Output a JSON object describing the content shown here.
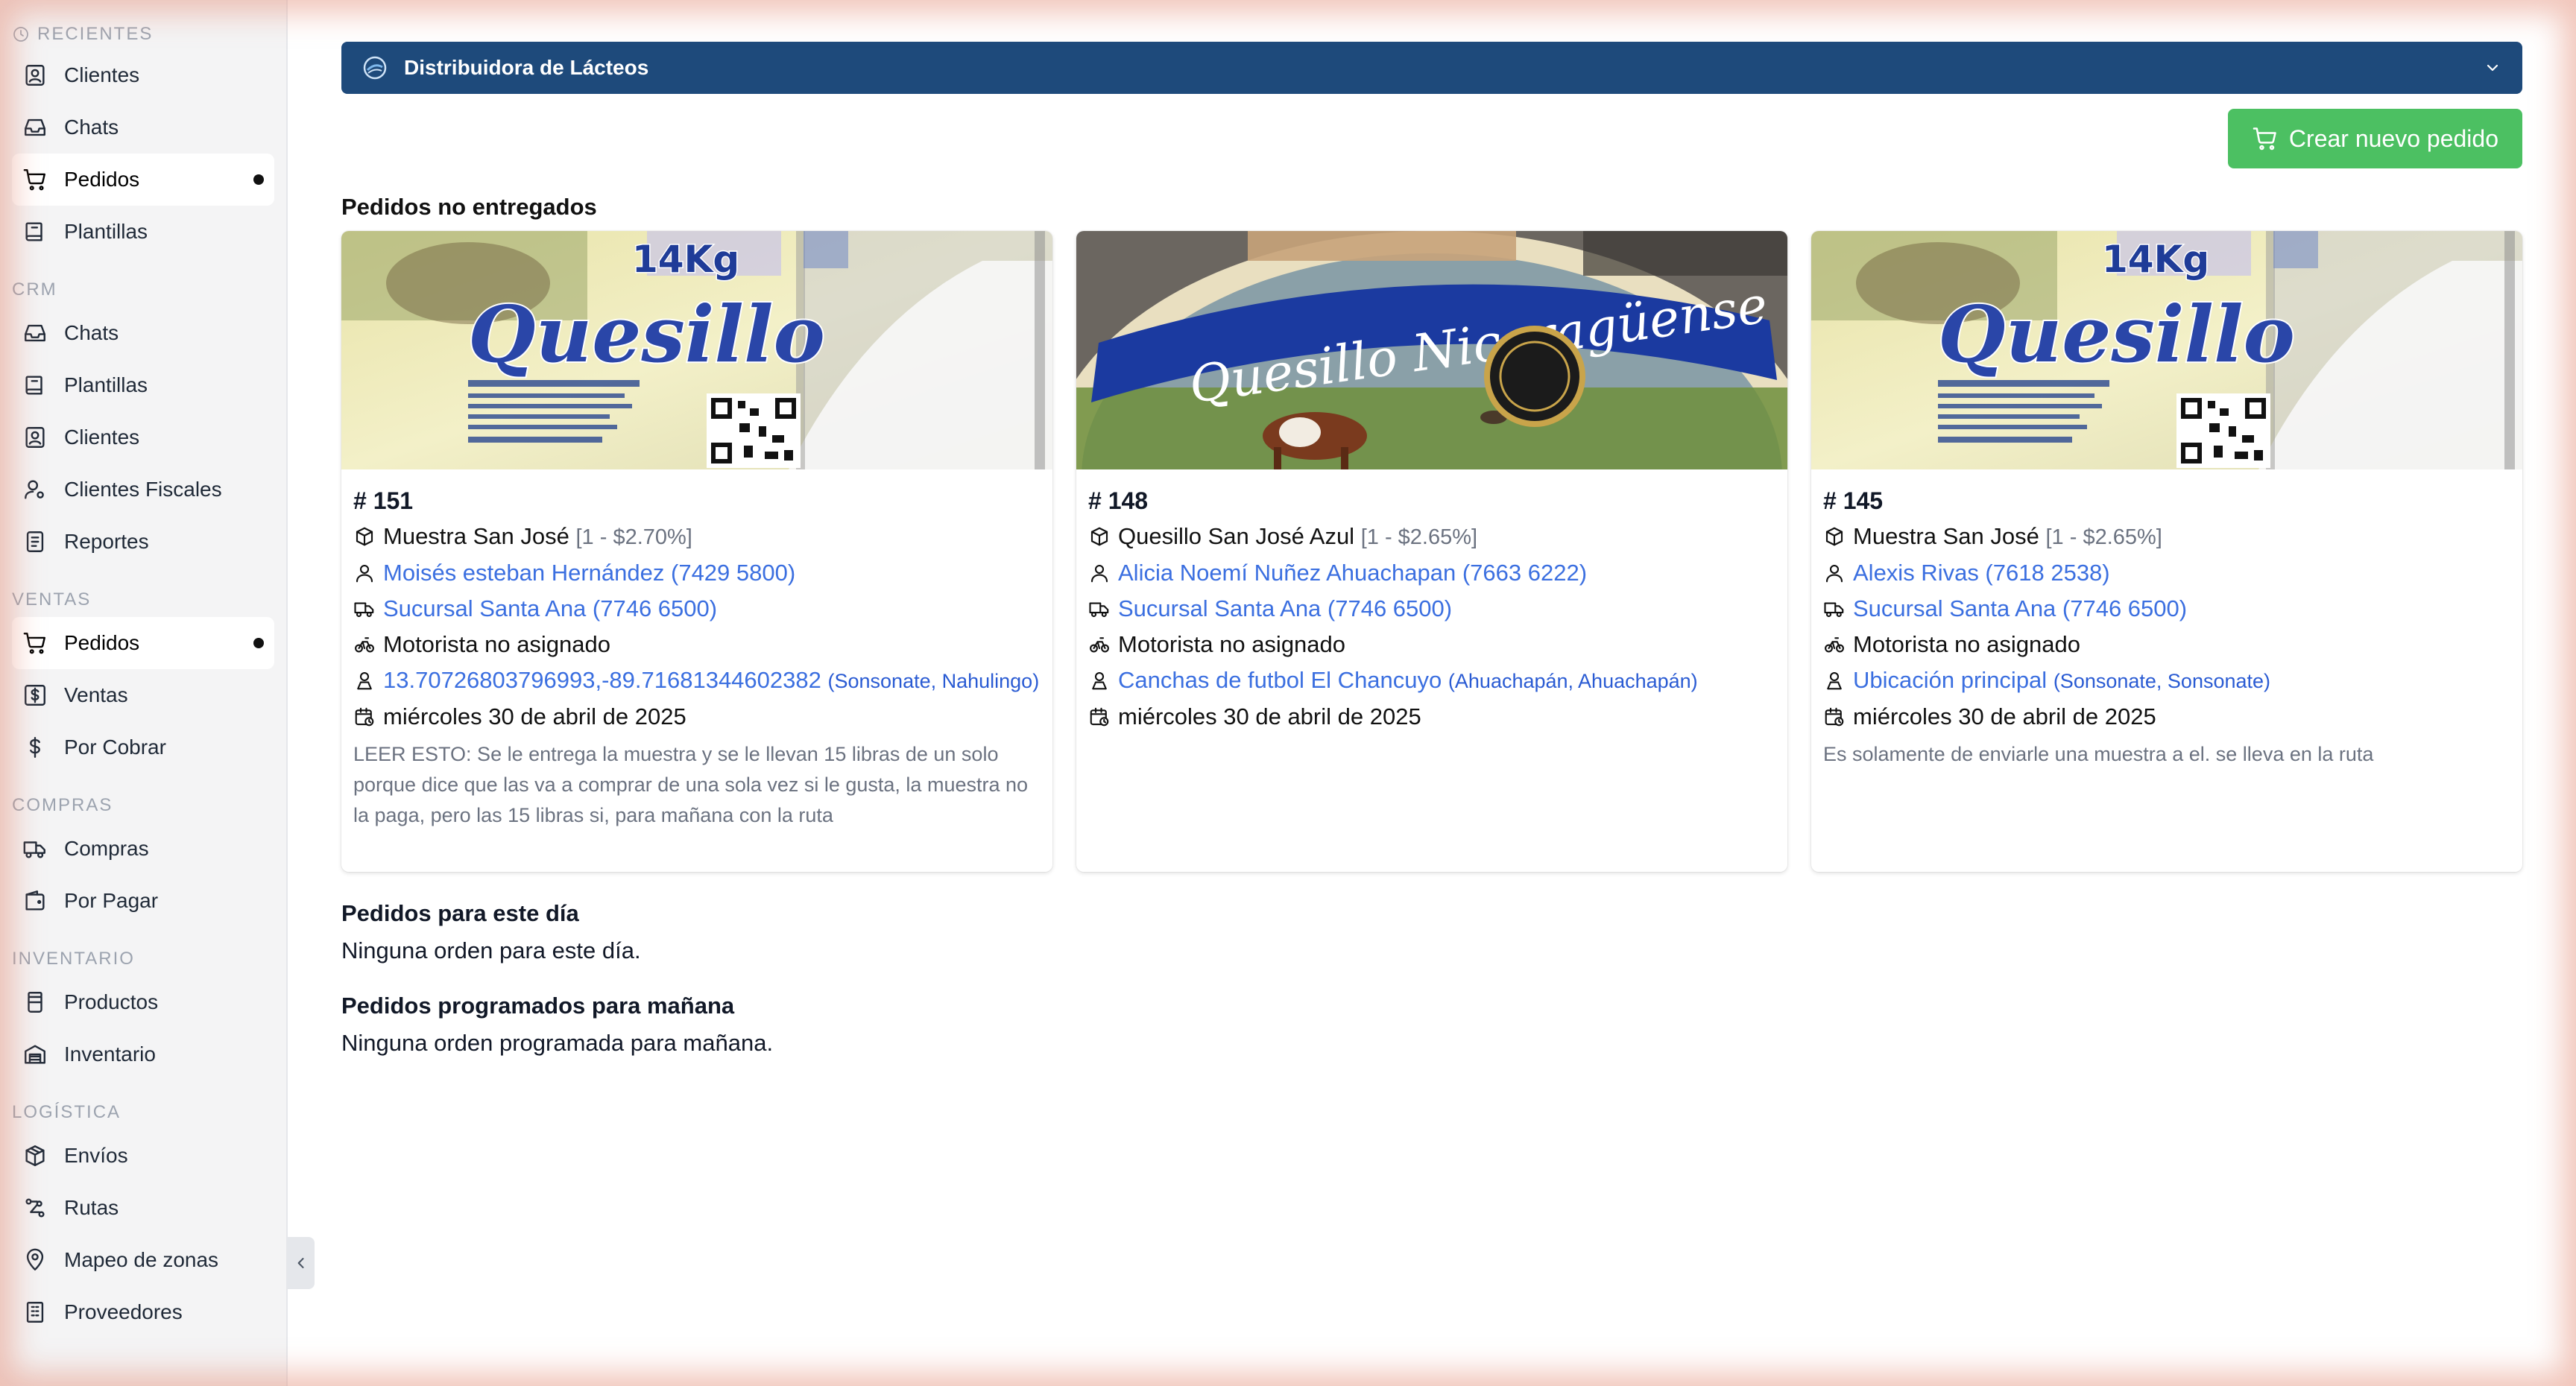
{
  "sidebar": {
    "sections": [
      {
        "title": "RECIENTES",
        "items": [
          {
            "label": "Clientes",
            "icon": "contact-card-icon",
            "active": false
          },
          {
            "label": "Chats",
            "icon": "inbox-icon",
            "active": false
          },
          {
            "label": "Pedidos",
            "icon": "cart-icon",
            "active": true
          },
          {
            "label": "Plantillas",
            "icon": "book-icon",
            "active": false
          }
        ]
      },
      {
        "title": "CRM",
        "items": [
          {
            "label": "Chats",
            "icon": "inbox-icon",
            "active": false
          },
          {
            "label": "Plantillas",
            "icon": "book-icon",
            "active": false
          },
          {
            "label": "Clientes",
            "icon": "contact-card-icon",
            "active": false
          },
          {
            "label": "Clientes Fiscales",
            "icon": "user-gear-icon",
            "active": false
          },
          {
            "label": "Reportes",
            "icon": "report-icon",
            "active": false
          }
        ]
      },
      {
        "title": "VENTAS",
        "items": [
          {
            "label": "Pedidos",
            "icon": "cart-icon",
            "active": true
          },
          {
            "label": "Ventas",
            "icon": "dollar-square-icon",
            "active": false
          },
          {
            "label": "Por Cobrar",
            "icon": "dollar-icon",
            "active": false
          }
        ]
      },
      {
        "title": "COMPRAS",
        "items": [
          {
            "label": "Compras",
            "icon": "truck-icon",
            "active": false
          },
          {
            "label": "Por Pagar",
            "icon": "wallet-icon",
            "active": false
          }
        ]
      },
      {
        "title": "INVENTARIO",
        "items": [
          {
            "label": "Productos",
            "icon": "jar-icon",
            "active": false
          },
          {
            "label": "Inventario",
            "icon": "warehouse-icon",
            "active": false
          }
        ]
      },
      {
        "title": "LOGÍSTICA",
        "items": [
          {
            "label": "Envíos",
            "icon": "package-icon",
            "active": false
          },
          {
            "label": "Rutas",
            "icon": "route-icon",
            "active": false
          },
          {
            "label": "Mapeo de zonas",
            "icon": "map-pin-icon",
            "active": false
          },
          {
            "label": "Proveedores",
            "icon": "building-icon",
            "active": false
          }
        ]
      }
    ]
  },
  "header": {
    "company": "Distribuidora de Lácteos",
    "new_order_label": "Crear nuevo pedido"
  },
  "sections": {
    "undelivered_title": "Pedidos no entregados",
    "today_title": "Pedidos para este día",
    "today_empty": "Ninguna orden para este día.",
    "tomorrow_title": "Pedidos programados para mañana",
    "tomorrow_empty": "Ninguna orden programada para mañana."
  },
  "orders": [
    {
      "number": "# 151",
      "image": "quesillo",
      "img_text": "Quesillo",
      "img_weight": "14Kg",
      "product": "Muestra San José",
      "product_meta": "[1 -  $2.70%]",
      "client": "Moisés esteban Hernández (7429 5800)",
      "branch": "Sucursal Santa Ana (7746 6500)",
      "driver": "Motorista no asignado",
      "location": "13.70726803796993,-89.71681344602382",
      "location_sub": "(Sonsonate, Nahulingo)",
      "date": "miércoles 30 de abril de 2025",
      "note": "LEER ESTO: Se le entrega la muestra y se le llevan 15 libras de un solo porque dice que las va a comprar de una sola vez si le gusta, la muestra no la paga, pero las 15 libras si, para mañana con la ruta"
    },
    {
      "number": "# 148",
      "image": "nicaraguense",
      "img_text": "Quesillo Nicaragüense",
      "img_weight": "",
      "product": "Quesillo San José Azul",
      "product_meta": "[1 -  $2.65%]",
      "client": "Alicia Noemí Nuñez Ahuachapan (7663 6222)",
      "branch": "Sucursal Santa Ana (7746 6500)",
      "driver": "Motorista no asignado",
      "location": "Canchas de futbol El Chancuyo",
      "location_sub": "(Ahuachapán, Ahuachapán)",
      "date": "miércoles 30 de abril de 2025",
      "note": ""
    },
    {
      "number": "# 145",
      "image": "quesillo",
      "img_text": "Quesillo",
      "img_weight": "14Kg",
      "product": "Muestra San José",
      "product_meta": "[1 -  $2.65%]",
      "client": "Alexis Rivas (7618 2538)",
      "branch": "Sucursal Santa Ana (7746 6500)",
      "driver": "Motorista no asignado",
      "location": "Ubicación principal",
      "location_sub": "(Sonsonate, Sonsonate)",
      "date": "miércoles 30 de abril de 2025",
      "note": "Es solamente de enviarle una muestra a el. se lleva en la ruta"
    }
  ]
}
